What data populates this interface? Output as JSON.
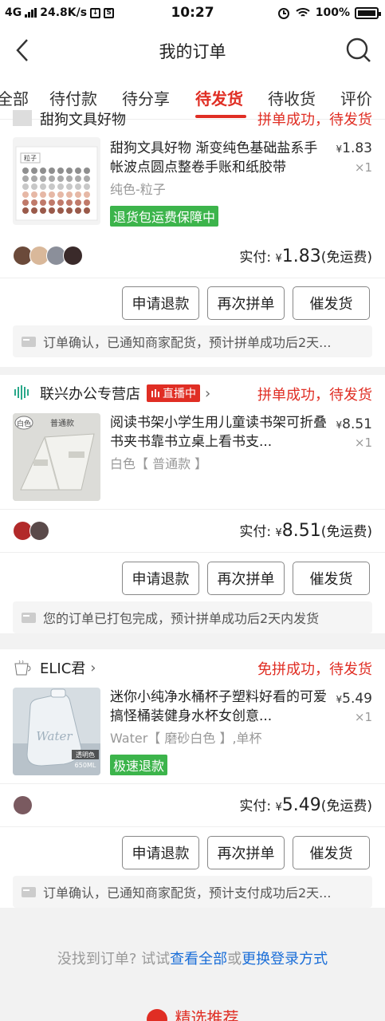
{
  "status_bar": {
    "network": "4G",
    "speed": "24.8K/s",
    "time": "10:27",
    "battery": "100%"
  },
  "header": {
    "title": "我的订单"
  },
  "tabs": [
    "全部",
    "待付款",
    "待分享",
    "待发货",
    "待收货",
    "评价"
  ],
  "active_tab": "待发货",
  "orders": [
    {
      "shop_name": "甜狗文具好物",
      "status": "拼单成功，待发货",
      "title": "甜狗文具好物 渐变纯色基础盐系手帐波点圆点整卷手账和纸胶带",
      "price": "1.83",
      "qty": "×1",
      "spec": "纯色-粒子",
      "tag": "退货包运费保障中",
      "thumb_label": "粒子",
      "paid_label": "实付:",
      "paid_amount": "1.83",
      "shipping": "(免运费)",
      "buttons": [
        "申请退款",
        "再次拼单",
        "催发货"
      ],
      "note": "订单确认，已通知商家配货，预计拼单成功后2天..."
    },
    {
      "shop_name": "联兴办公专营店",
      "live": "直播中",
      "status": "拼单成功，待发货",
      "title": "阅读书架小学生用儿童读书架可折叠书夹书靠书立桌上看书支...",
      "price": "8.51",
      "qty": "×1",
      "spec": "白色【 普通款 】",
      "thumb_labels": [
        "白色",
        "普通款"
      ],
      "paid_label": "实付:",
      "paid_amount": "8.51",
      "shipping": "(免运费)",
      "buttons": [
        "申请退款",
        "再次拼单",
        "催发货"
      ],
      "note": "您的订单已打包完成，预计拼单成功后2天内发货"
    },
    {
      "shop_name": "ELIC君",
      "status": "免拼成功，待发货",
      "title": "迷你小纯净水桶杯子塑料好看的可爱搞怪桶装健身水杯女创意...",
      "price": "5.49",
      "qty": "×1",
      "spec": "Water【 磨砂白色 】,单杯",
      "tag": "极速退款",
      "thumb_labels": [
        "Water",
        "透明色",
        "650ML"
      ],
      "paid_label": "实付:",
      "paid_amount": "5.49",
      "shipping": "(免运费)",
      "buttons": [
        "申请退款",
        "再次拼单",
        "催发货"
      ],
      "note": "订单确认，已通知商家配货，预计支付成功后2天..."
    }
  ],
  "footer": {
    "prefix": "没找到订单?  试试",
    "link1": "查看全部",
    "or": "或",
    "link2": "更换登录方式",
    "recommend": "精选推荐"
  },
  "colors": {
    "accent": "#e02e24",
    "green": "#3cb44b",
    "link": "#1a6ed8"
  }
}
